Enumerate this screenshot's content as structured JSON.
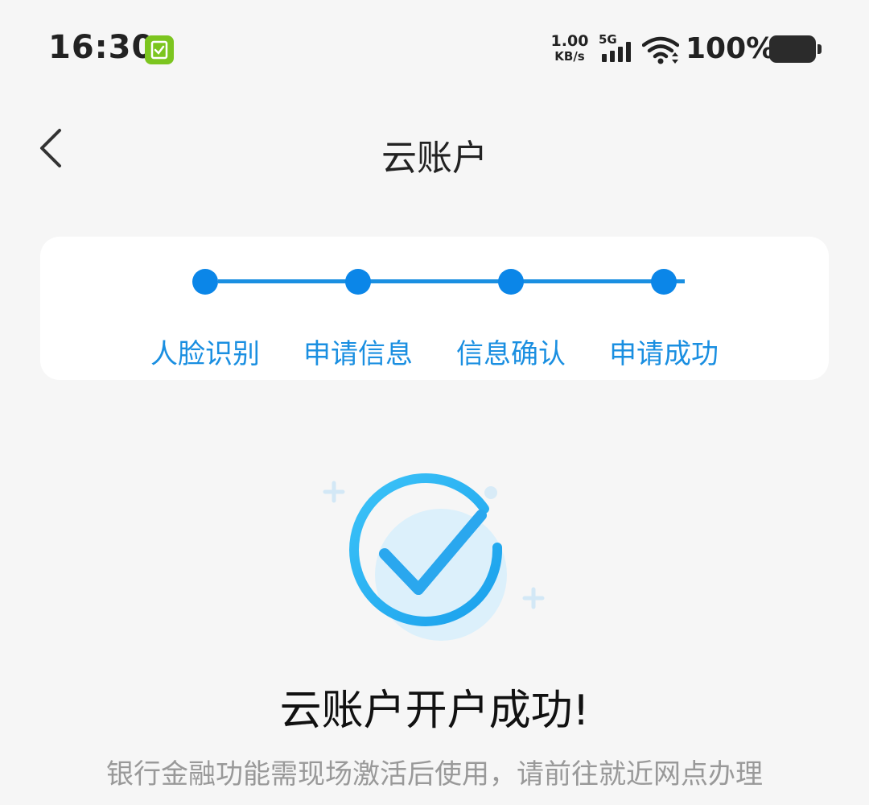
{
  "status_bar": {
    "time": "16:30",
    "net_speed_value": "1.00",
    "net_speed_unit": "KB/s",
    "network_type": "5G",
    "battery_percent": "100%",
    "badge_icon": "shield-check-icon",
    "badge_color": "#7cc51f"
  },
  "nav": {
    "title": "云账户",
    "back_icon": "chevron-left-icon"
  },
  "steps": {
    "items": [
      {
        "label": "人脸识别"
      },
      {
        "label": "申请信息"
      },
      {
        "label": "信息确认"
      },
      {
        "label": "申请成功"
      }
    ],
    "active_color": "#0b86e8"
  },
  "result": {
    "icon": "success-check-icon",
    "title": "云账户开户成功!",
    "description": "银行金融功能需现场激活后使用，请前往就近网点办理"
  }
}
